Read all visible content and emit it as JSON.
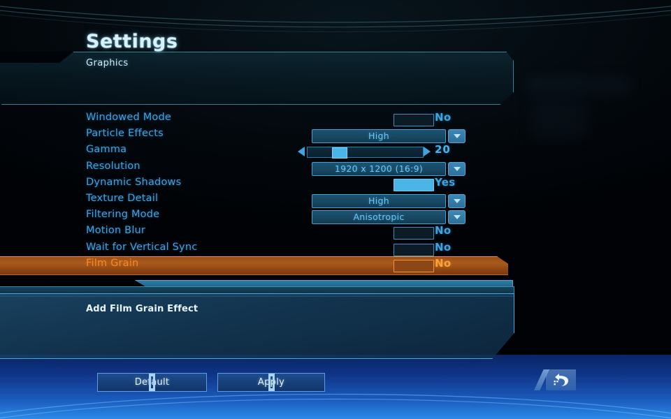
{
  "title": "Settings",
  "category": "Graphics",
  "colors": {
    "label_blue": "#3fa5e0",
    "value_blue": "#3fa5e0",
    "selected_orange": "#f08a2a",
    "panel_border": "#4ea7cf",
    "accent_cyan": "#4bb5e8"
  },
  "settings": [
    {
      "label": "Windowed Mode",
      "type": "checkbox",
      "value": "No",
      "checked": false,
      "selected": false
    },
    {
      "label": "Particle Effects",
      "type": "dropdown",
      "value": "High",
      "selected": false
    },
    {
      "label": "Gamma",
      "type": "slider",
      "value": "20",
      "percent": 24,
      "selected": false
    },
    {
      "label": "Resolution",
      "type": "dropdown",
      "value": "1920 x 1200 (16:9)",
      "selected": false
    },
    {
      "label": "Dynamic Shadows",
      "type": "checkbox",
      "value": "Yes",
      "checked": true,
      "selected": false
    },
    {
      "label": "Texture Detail",
      "type": "dropdown",
      "value": "High",
      "selected": false
    },
    {
      "label": "Filtering Mode",
      "type": "dropdown",
      "value": "Anisotropic",
      "selected": false
    },
    {
      "label": "Motion Blur",
      "type": "checkbox",
      "value": "No",
      "checked": false,
      "selected": false
    },
    {
      "label": "Wait for Vertical Sync",
      "type": "checkbox",
      "value": "No",
      "checked": false,
      "selected": false
    },
    {
      "label": "Film Grain",
      "type": "checkbox",
      "value": "No",
      "checked": false,
      "selected": true
    }
  ],
  "description": "Add Film Grain Effect",
  "buttons": {
    "default_label": "Default",
    "apply_label": "Apply",
    "back_icon": "back-arrow-icon"
  },
  "icons": {
    "dropdown": "chevron-down-icon",
    "slider_left": "arrow-left-icon",
    "slider_right": "arrow-right-icon"
  }
}
